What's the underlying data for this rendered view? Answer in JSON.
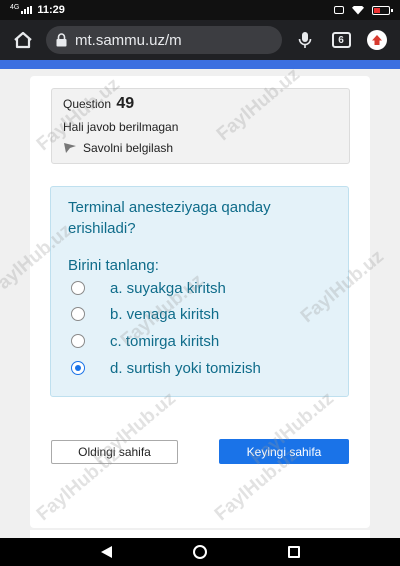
{
  "status_bar": {
    "network": "4G",
    "time": "11:29"
  },
  "browser": {
    "url": "mt.sammu.uz/m",
    "tab_count": "6"
  },
  "question": {
    "label": "Question",
    "number": "49",
    "state": "Hali javob berilmagan",
    "flag_label": "Savolni belgilash",
    "text": "Terminal anesteziyaga qanday erishiladi?",
    "prompt": "Birini tanlang:",
    "options": [
      {
        "label": "a. suyakga kiritsh",
        "checked": false
      },
      {
        "label": "b. venaga kiritsh",
        "checked": false
      },
      {
        "label": "c. tomirga kiritsh",
        "checked": false
      },
      {
        "label": "d. surtish yoki tomizish",
        "checked": true
      }
    ]
  },
  "buttons": {
    "prev": "Oldingi sahifa",
    "next": "Keyingi sahifa"
  },
  "watermark": "FaylHub.uz",
  "colors": {
    "accent": "#1a73e8",
    "question_text": "#0f6c8a",
    "strip": "#3b6fe0"
  }
}
